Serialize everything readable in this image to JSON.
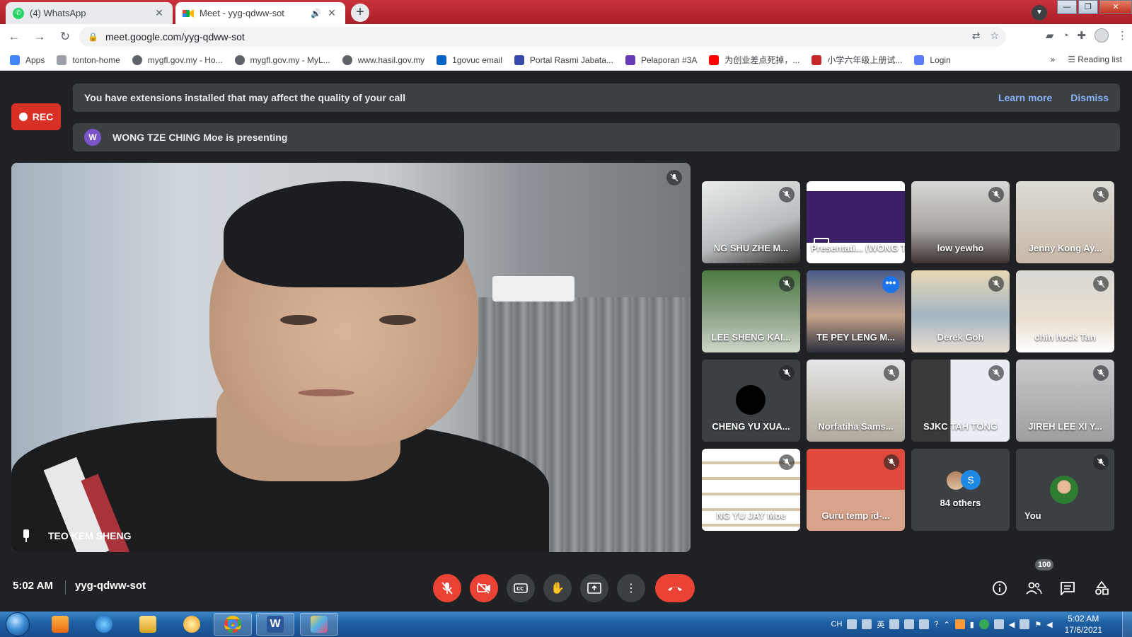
{
  "browser": {
    "tabs": [
      {
        "title": "(4) WhatsApp",
        "active": false
      },
      {
        "title": "Meet - yyg-qdww-sot",
        "active": true
      }
    ],
    "url": "meet.google.com/yyg-qdww-sot",
    "bookmarks": [
      {
        "label": "Apps",
        "icon": "apps-grid-icon",
        "color": "#4285f4"
      },
      {
        "label": "tonton-home",
        "icon": "tonton-icon",
        "color": "#9aa0a6"
      },
      {
        "label": "mygfl.gov.my - Ho...",
        "icon": "globe-icon",
        "color": "#5f6368"
      },
      {
        "label": "mygfl.gov.my - MyL...",
        "icon": "globe-icon",
        "color": "#5f6368"
      },
      {
        "label": "www.hasil.gov.my",
        "icon": "globe-icon",
        "color": "#5f6368"
      },
      {
        "label": "1govuc email",
        "icon": "outlook-icon",
        "color": "#0a64c8"
      },
      {
        "label": "Portal Rasmi Jabata...",
        "icon": "portal-icon",
        "color": "#3949ab"
      },
      {
        "label": "Pelaporan #3A",
        "icon": "forms-icon",
        "color": "#673ab7"
      },
      {
        "label": "为创业差点死掉，...",
        "icon": "youtube-icon",
        "color": "#ff0000"
      },
      {
        "label": "小学六年级上册试...",
        "icon": "doc-icon",
        "color": "#c62828"
      },
      {
        "label": "Login",
        "icon": "login-icon",
        "color": "#5c7cfa"
      }
    ],
    "bookmarks_overflow": "»",
    "reading_list": "Reading list"
  },
  "meet": {
    "rec_label": "REC",
    "extension_notice": "You have extensions installed that may affect the quality of your call",
    "learn_more": "Learn more",
    "dismiss": "Dismiss",
    "presenter_initial": "W",
    "presenting_text": "WONG TZE CHING Moe is presenting",
    "main_speaker": "TEO KEM SHENG",
    "participants": [
      {
        "name": "NG SHU ZHE M...",
        "muted": true
      },
      {
        "name": "Presentati... (WONG TZ...",
        "muted": false
      },
      {
        "name": "low yewho",
        "muted": true
      },
      {
        "name": "Jenny Kong Ay...",
        "muted": true
      },
      {
        "name": "LEE SHENG KAI...",
        "muted": true
      },
      {
        "name": "TE PEY LENG M...",
        "muted": false,
        "speaking": true
      },
      {
        "name": "Derek Goh",
        "muted": true
      },
      {
        "name": "chin hock Tan",
        "muted": true
      },
      {
        "name": "CHENG YU XUA...",
        "muted": true
      },
      {
        "name": "Norfatiha Sams...",
        "muted": true
      },
      {
        "name": "SJKC TAH TONG",
        "muted": true
      },
      {
        "name": "JIREH LEE XI Y...",
        "muted": true
      },
      {
        "name": "NG YU JAY Moe",
        "muted": true
      },
      {
        "name": "Guru temp id-...",
        "muted": true
      },
      {
        "name": "84 others",
        "muted": false
      },
      {
        "name": "You",
        "muted": true
      }
    ],
    "others_initial": "S",
    "time": "5:02 AM",
    "meeting_code": "yyg-qdww-sot",
    "participant_count": "100"
  },
  "taskbar": {
    "ime": "CH",
    "clock_time": "5:02 AM",
    "clock_date": "17/6/2021"
  },
  "colors": {
    "meet_bg": "#202124",
    "danger": "#ea4335",
    "link": "#8ab4f8",
    "speaking": "#1a73e8"
  }
}
